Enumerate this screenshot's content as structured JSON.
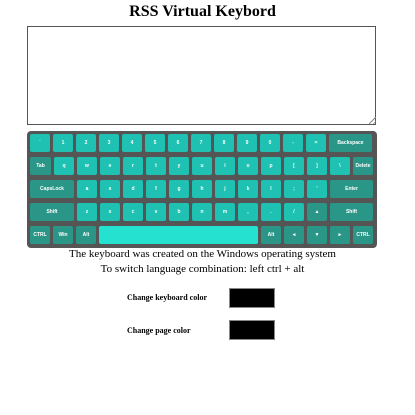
{
  "title": "RSS Virtual Keybord",
  "textarea": {
    "value": ""
  },
  "keyboard": {
    "colors": {
      "key": "#1fc1b2",
      "special_key": "#2a9688",
      "space": "#25e1cf",
      "background": "#555555"
    },
    "rows": [
      [
        {
          "label": "`"
        },
        {
          "label": "1"
        },
        {
          "label": "2"
        },
        {
          "label": "3"
        },
        {
          "label": "4"
        },
        {
          "label": "5"
        },
        {
          "label": "6"
        },
        {
          "label": "7"
        },
        {
          "label": "8"
        },
        {
          "label": "9"
        },
        {
          "label": "0"
        },
        {
          "label": "-"
        },
        {
          "label": "="
        },
        {
          "label": "Backspace",
          "special": true
        }
      ],
      [
        {
          "label": "Tab",
          "special": true
        },
        {
          "label": "q"
        },
        {
          "label": "w"
        },
        {
          "label": "e"
        },
        {
          "label": "r"
        },
        {
          "label": "t"
        },
        {
          "label": "y"
        },
        {
          "label": "u"
        },
        {
          "label": "i"
        },
        {
          "label": "o"
        },
        {
          "label": "p"
        },
        {
          "label": "["
        },
        {
          "label": "]"
        },
        {
          "label": "\\"
        },
        {
          "label": "Delete",
          "special": true
        }
      ],
      [
        {
          "label": "CapsLock",
          "special": true
        },
        {
          "label": "a"
        },
        {
          "label": "s"
        },
        {
          "label": "d"
        },
        {
          "label": "f"
        },
        {
          "label": "g"
        },
        {
          "label": "h"
        },
        {
          "label": "j"
        },
        {
          "label": "k"
        },
        {
          "label": "l"
        },
        {
          "label": ";"
        },
        {
          "label": "'"
        },
        {
          "label": "Enter",
          "special": true
        }
      ],
      [
        {
          "label": "Shift",
          "special": true
        },
        {
          "label": "z"
        },
        {
          "label": "x"
        },
        {
          "label": "c"
        },
        {
          "label": "v"
        },
        {
          "label": "b"
        },
        {
          "label": "n"
        },
        {
          "label": "m"
        },
        {
          "label": ","
        },
        {
          "label": "."
        },
        {
          "label": "/"
        },
        {
          "label": "▲",
          "special": true
        },
        {
          "label": "Shift",
          "special": true
        }
      ],
      [
        {
          "label": "CTRL",
          "special": true
        },
        {
          "label": "Win",
          "special": true
        },
        {
          "label": "Alt",
          "special": true
        },
        {
          "label": " ",
          "space": true
        },
        {
          "label": "Alt",
          "special": true
        },
        {
          "label": "◄",
          "special": true
        },
        {
          "label": "▼",
          "special": true
        },
        {
          "label": "►",
          "special": true
        },
        {
          "label": "CTRL",
          "special": true
        }
      ]
    ]
  },
  "info": {
    "line1": "The keyboard was created on the Windows operating system",
    "line2": "To switch language combination: left ctrl + alt"
  },
  "settings": {
    "keyboard_color_label": "Change keyboard color",
    "keyboard_color_value": "#000000",
    "page_color_label": "Change page color",
    "page_color_value": "#000000"
  }
}
